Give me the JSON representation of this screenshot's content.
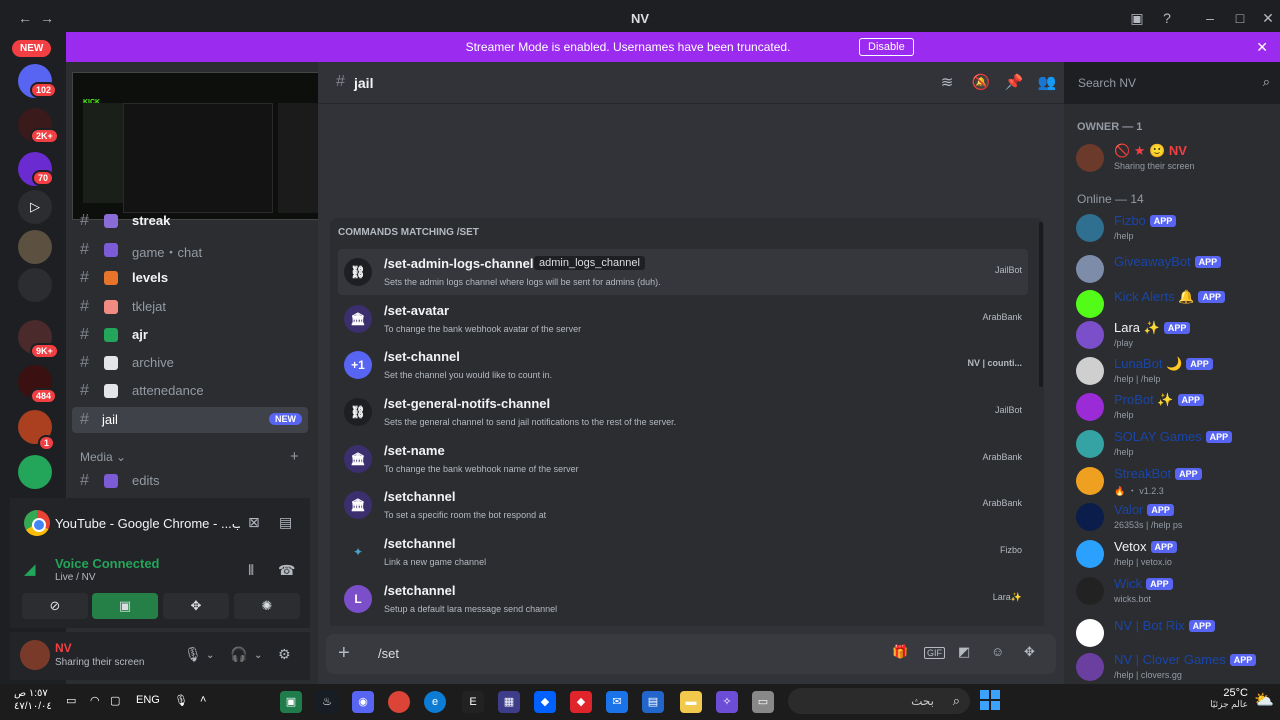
{
  "window": {
    "title": "NV"
  },
  "banner": {
    "message": "Streamer Mode is enabled. Usernames have been truncated.",
    "disable_label": "Disable"
  },
  "rail": {
    "new_label": "NEW",
    "badges": [
      "102",
      "2K+",
      "70",
      "9K+",
      "484",
      "1"
    ]
  },
  "channels": [
    {
      "name": "streak",
      "unread": true
    },
    {
      "name": "game・chat",
      "unread": false
    },
    {
      "name": "levels",
      "unread": true
    },
    {
      "name": "tklejat",
      "unread": false
    },
    {
      "name": "ajr",
      "unread": true
    },
    {
      "name": "archive",
      "unread": false
    },
    {
      "name": "attenedance",
      "unread": false
    }
  ],
  "selected_channel": {
    "name": "jail",
    "tag": "NEW"
  },
  "category": {
    "name": "Media",
    "channel": "edits"
  },
  "stream_panel": {
    "title": "YouTube - Google Chrome - ...يوتيوب"
  },
  "voice": {
    "status": "Voice Connected",
    "location": "Live / NV"
  },
  "user": {
    "name": "NV",
    "status": "Sharing their screen"
  },
  "header": {
    "channel": "jail",
    "search_placeholder": "Search NV"
  },
  "autocomplete": {
    "heading": "COMMANDS MATCHING /SET",
    "commands": [
      {
        "name": "/set-admin-logs-channel",
        "option": "admin_logs_channel",
        "desc": "Sets the admin logs channel where logs will be sent for admins (duh).",
        "bot": "JailBot",
        "icon": "jailbot"
      },
      {
        "name": "/set-avatar",
        "option": "",
        "desc": "To change the bank webhook avatar of the server",
        "bot": "ArabBank",
        "icon": "arabbank"
      },
      {
        "name": "/set-channel",
        "option": "",
        "desc": "Set the channel you would like to count in.",
        "bot": "NV | counti...",
        "icon": "+1"
      },
      {
        "name": "/set-general-notifs-channel",
        "option": "",
        "desc": "Sets the general channel to send jail notifications to the rest of the server.",
        "bot": "JailBot",
        "icon": "jailbot"
      },
      {
        "name": "/set-name",
        "option": "",
        "desc": "To change the bank webhook name of the server",
        "bot": "ArabBank",
        "icon": "arabbank"
      },
      {
        "name": "/setchannel",
        "option": "",
        "desc": "To set a specific room the bot respond at",
        "bot": "ArabBank",
        "icon": "arabbank"
      },
      {
        "name": "/setchannel",
        "option": "",
        "desc": "Link a new game channel",
        "bot": "Fizbo",
        "icon": "fizbo"
      },
      {
        "name": "/setchannel",
        "option": "",
        "desc": "Setup a default lara message send channel",
        "bot": "Lara✨",
        "icon": "lara"
      }
    ]
  },
  "input": {
    "value": "/set"
  },
  "members": {
    "owner_heading": "OWNER — 1",
    "owner": {
      "name": "NV",
      "status": "Sharing their screen"
    },
    "online_heading": "Online — 14",
    "list": [
      {
        "name": "Fizbo",
        "status": "/help",
        "app": "APP",
        "blur": true,
        "color": "#2f6f8f"
      },
      {
        "name": "GiveawayBot",
        "status": "",
        "app": "APP",
        "blur": true,
        "color": "#7d8ca8"
      },
      {
        "name": "Kick Alerts 🔔",
        "status": "",
        "app": "APP",
        "blur": true,
        "color": "#53fc18"
      },
      {
        "name": "Lara ✨",
        "status": "/play",
        "app": "APP",
        "blur": false,
        "color": "#7b4fc9"
      },
      {
        "name": "LunaBot 🌙",
        "status": "/help | /help",
        "app": "APP",
        "blur": true,
        "color": "#cfcfcf"
      },
      {
        "name": "ProBot ✨",
        "status": "/help",
        "app": "APP",
        "blur": true,
        "color": "#9b2bd6"
      },
      {
        "name": "SOLAY Games",
        "status": "/help",
        "app": "APP",
        "blur": true,
        "color": "#35a3a3"
      },
      {
        "name": "StreakBot",
        "status": "🔥 ・ v1.2.3",
        "app": "APP",
        "blur": true,
        "color": "#f0a020"
      },
      {
        "name": "Valor",
        "status": "26353s | /help ps",
        "app": "APP",
        "blur": true,
        "color": "#0b1d4a"
      },
      {
        "name": "Vetox",
        "status": "/help | vetox.io",
        "app": "APP",
        "blur": false,
        "color": "#2aa0ff"
      },
      {
        "name": "Wick",
        "status": "wicks.bot",
        "app": "APP",
        "blur": true,
        "color": "#222222"
      },
      {
        "name": "NV | Bot Rix",
        "status": "",
        "app": "APP",
        "blur": true,
        "color": "#ffffff"
      },
      {
        "name": "NV | Clover Games",
        "status": "/help | clovers.gg",
        "app": "APP",
        "blur": true,
        "color": "#6b3fa0"
      }
    ]
  },
  "taskbar": {
    "language": "ENG",
    "search_label": "بحث",
    "time": "١:٥٧ ص",
    "date": "٤٧/١٠/٠٤",
    "weather_temp": "25°C",
    "weather_desc": "عالم جزئيًا"
  }
}
